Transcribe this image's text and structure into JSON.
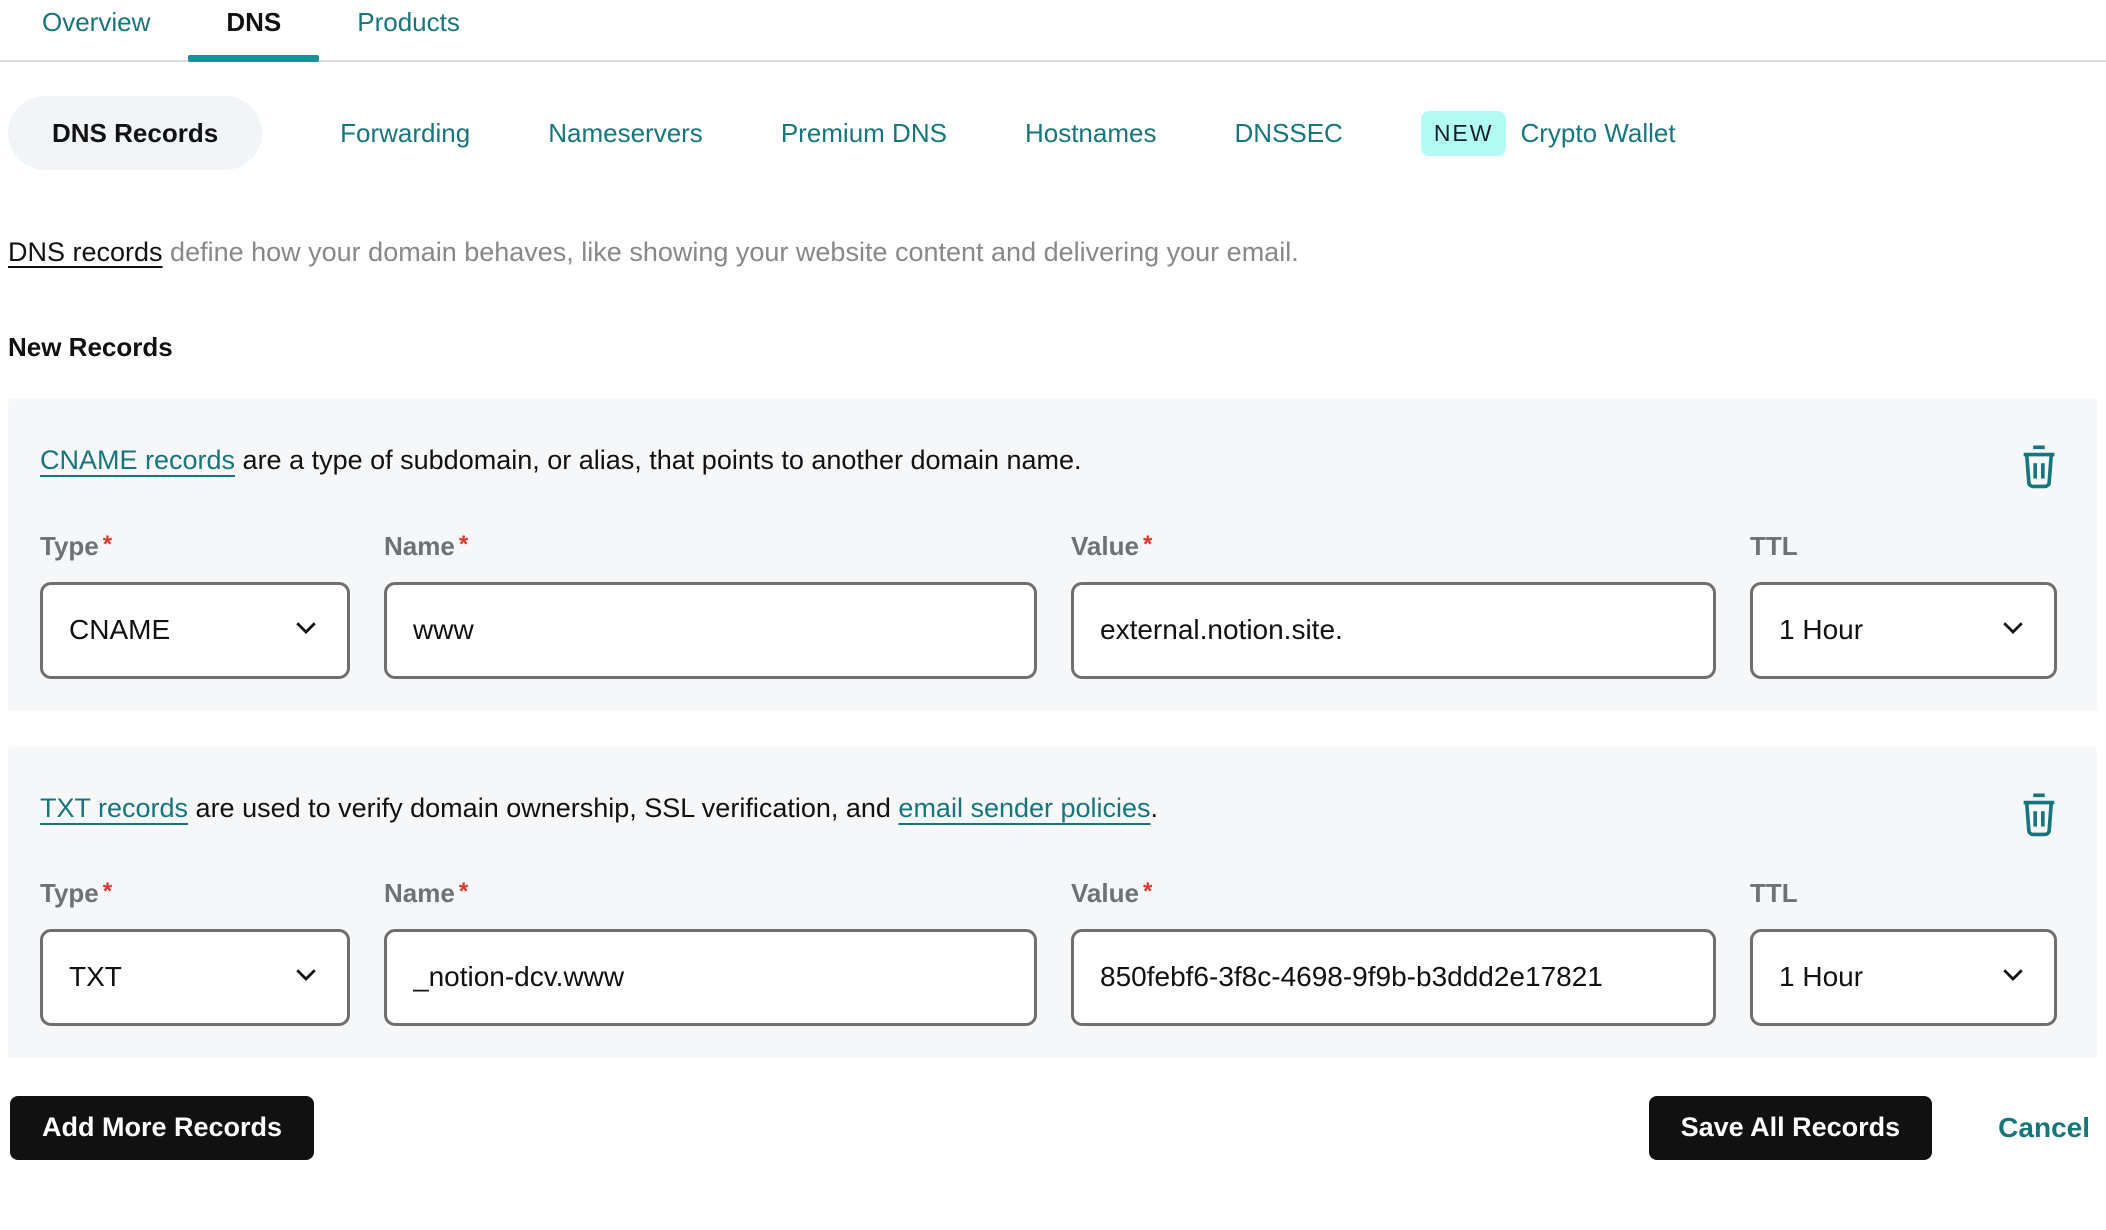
{
  "colors": {
    "teal": "#17767c",
    "teal_underline": "#17929b",
    "badge_bg": "#b2fcf4",
    "card_bg": "#f5f7f8",
    "button_bg": "#111111",
    "required_red": "#d9382d",
    "label_gray": "#6e7176",
    "intro_gray": "#888888",
    "input_border": "#6f6f6f"
  },
  "tabs": [
    {
      "label": "Overview",
      "active": false
    },
    {
      "label": "DNS",
      "active": true
    },
    {
      "label": "Products",
      "active": false
    }
  ],
  "subtabs": [
    {
      "label": "DNS Records",
      "active": true
    },
    {
      "label": "Forwarding"
    },
    {
      "label": "Nameservers"
    },
    {
      "label": "Premium DNS"
    },
    {
      "label": "Hostnames"
    },
    {
      "label": "DNSSEC"
    },
    {
      "label": "Crypto Wallet",
      "badge": "NEW"
    }
  ],
  "intro": {
    "link": "DNS records",
    "text": " define how your domain behaves, like showing your website content and delivering your email."
  },
  "section_title": "New Records",
  "labels": {
    "type": "Type",
    "name": "Name",
    "value": "Value",
    "ttl": "TTL",
    "required": "*"
  },
  "records": [
    {
      "desc_link1": "CNAME records",
      "desc_text1": " are a type of subdomain, or alias, that points to another domain name.",
      "desc_link2": "",
      "desc_text2": "",
      "type": "CNAME",
      "name": "www",
      "value": "external.notion.site.",
      "ttl": "1 Hour"
    },
    {
      "desc_link1": "TXT records",
      "desc_text1": " are used to verify domain ownership, SSL verification, and ",
      "desc_link2": "email sender policies",
      "desc_text2": ".",
      "type": "TXT",
      "name": "_notion-dcv.www",
      "value": "850febf6-3f8c-4698-9f9b-b3ddd2e17821",
      "ttl": "1 Hour"
    }
  ],
  "footer": {
    "add_label": "Add More Records",
    "save_label": "Save All Records",
    "cancel_label": "Cancel"
  },
  "icons": {
    "delete": "trash-icon",
    "select": "chevron-down-icon"
  }
}
